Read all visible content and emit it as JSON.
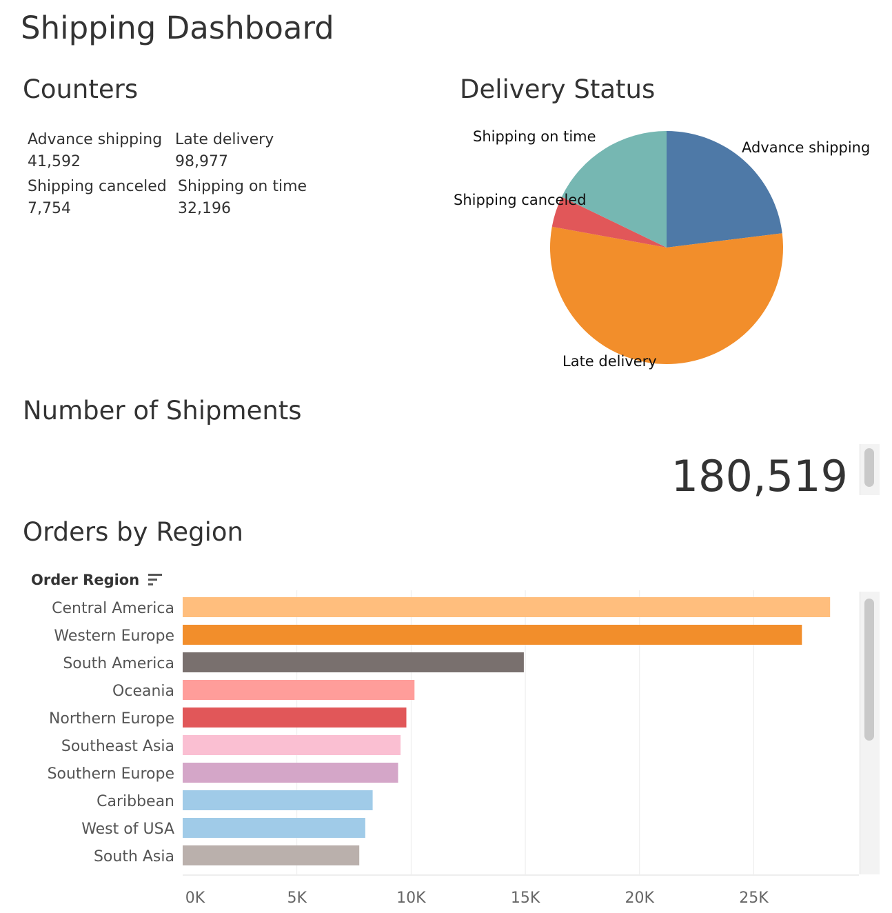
{
  "dashboard": {
    "title": "Shipping Dashboard"
  },
  "counters": {
    "title": "Counters",
    "items": [
      {
        "label": "Advance shipping",
        "value": "41,592"
      },
      {
        "label": "Late delivery",
        "value": "98,977"
      },
      {
        "label": "Shipping canceled",
        "value": "7,754"
      },
      {
        "label": "Shipping on time",
        "value": "32,196"
      }
    ]
  },
  "shipments": {
    "title": "Number of Shipments",
    "value": "180,519"
  },
  "region_section": {
    "title": "Orders by Region",
    "field_label": "Order Region",
    "sort_icon": "sort-descending-icon"
  },
  "chart_data": [
    {
      "type": "pie",
      "title": "Delivery Status",
      "slices": [
        {
          "label": "Advance shipping",
          "value": 41592,
          "color": "#4e79a7"
        },
        {
          "label": "Late delivery",
          "value": 98977,
          "color": "#f28e2b"
        },
        {
          "label": "Shipping canceled",
          "value": 7754,
          "color": "#e15759"
        },
        {
          "label": "Shipping on time",
          "value": 32196,
          "color": "#76b7b2"
        }
      ]
    },
    {
      "type": "bar",
      "orientation": "horizontal",
      "title": "Orders by Region",
      "ylabel": "Order Region",
      "categories": [
        "Central America",
        "Western Europe",
        "South America",
        "Oceania",
        "Northern Europe",
        "Southeast Asia",
        "Southern Europe",
        "Caribbean",
        "West of USA",
        "South Asia"
      ],
      "values": [
        28341,
        27109,
        14935,
        10148,
        9792,
        9539,
        9431,
        8318,
        7993,
        7731
      ],
      "colors": [
        "#ffbe7d",
        "#f28e2b",
        "#79706e",
        "#ff9d9a",
        "#e15759",
        "#fabfd2",
        "#d4a6c8",
        "#a0cbe8",
        "#a0cbe8",
        "#bab0ac"
      ],
      "xticks": [
        "0K",
        "5K",
        "10K",
        "15K",
        "20K",
        "25K"
      ],
      "xlim": [
        0,
        30000
      ],
      "grid": true
    }
  ]
}
